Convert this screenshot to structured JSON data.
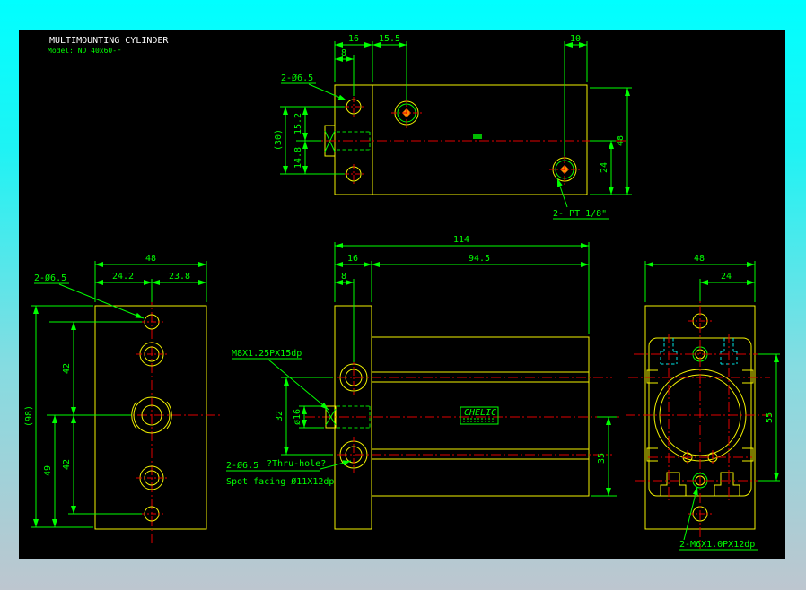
{
  "title_block": {
    "name": "MULTIMOUNTING CYLINDER",
    "model": "Model: ND 40x60-F"
  },
  "colors": {
    "background_top": "#00ffff",
    "background_bottom": "#bdc6cf",
    "canvas": "#000000",
    "outline": "#f2f200",
    "dimension": "#00ff00",
    "centerline": "#e00000",
    "hidden_detail": "#00e8e8",
    "title_text": "#ffffff",
    "port_marker": "#ff8800"
  },
  "top_view": {
    "dim_16": "16",
    "dim_15_5": "15.5",
    "dim_8": "8",
    "dim_10": "10",
    "dim_48": "48",
    "dim_24": "24",
    "dim_30": "(30)",
    "dim_15_2": "15.2",
    "dim_14_8": "14.8",
    "label_holes": "2-Ø6.5",
    "label_ports": "2- PT 1/8\""
  },
  "front_view": {
    "dim_48": "48",
    "dim_24_2": "24.2",
    "dim_23_8": "23.8",
    "dim_98": "(98)",
    "dim_42_upper": "42",
    "dim_42_lower": "42",
    "dim_49": "49",
    "label_holes": "2-Ø6.5"
  },
  "side_view": {
    "dim_114": "114",
    "dim_16": "16",
    "dim_94_5": "94.5",
    "dim_8": "8",
    "dim_32": "32",
    "dim_rod_dia": "ø16",
    "dim_35": "35",
    "label_thread": "M8X1.25PX15dp",
    "label_thru": "2-Ø6.5",
    "label_thru_note": "?Thru-hole?",
    "label_spotface": "Spot facing Ø11X12dp",
    "logo": "CHELIC"
  },
  "end_view": {
    "dim_48": "48",
    "dim_24": "24",
    "dim_55": "55",
    "label_thread": "2-M6X1.0PX12dp"
  }
}
